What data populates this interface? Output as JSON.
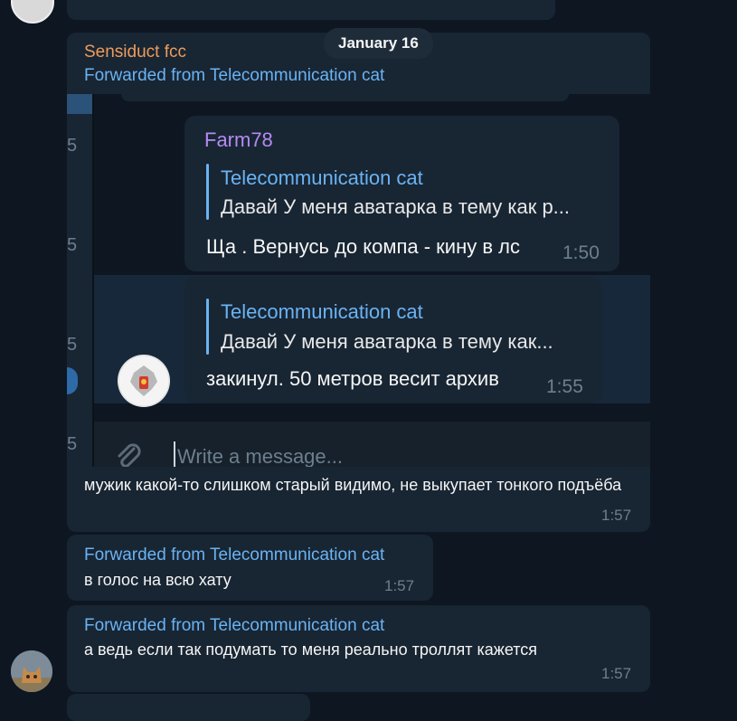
{
  "date_label": "January 16",
  "forwarded_post": {
    "sender": "Sensiduct fcc",
    "forwarded_from": "Forwarded from Telecommunication cat",
    "screenshot": {
      "side_numbers": [
        "5",
        "5",
        "5",
        "5"
      ],
      "message1": {
        "sender": "Farm78",
        "reply_name": "Telecommunication cat",
        "reply_text": "Давай У меня аватарка в тему как р...",
        "text": "Ща . Вернусь до компа - кину в лс",
        "time": "1:50"
      },
      "message2": {
        "reply_name": "Telecommunication cat",
        "reply_text": "Давай У меня аватарка в тему как...",
        "text": "закинул. 50 метров весит архив",
        "time": "1:55"
      },
      "composer_placeholder": "Write a message..."
    },
    "text": "мужик какой-то слишком старый видимо, не выкупает тонкого подъёба",
    "time": "1:57"
  },
  "message2": {
    "forwarded_from": "Forwarded from Telecommunication cat",
    "text": "в голос на всю хату",
    "time": "1:57"
  },
  "message3": {
    "forwarded_from": "Forwarded from Telecommunication cat",
    "text": "а ведь если так подумать то меня реально троллят кажется",
    "time": "1:57"
  },
  "colors": {
    "background": "#0e1621",
    "bubble": "#182533",
    "sender_orange": "#ee9c5a",
    "link_blue": "#6ab3f3",
    "farm_purple": "#b48bf2",
    "time_gray": "#6d7f8f"
  }
}
